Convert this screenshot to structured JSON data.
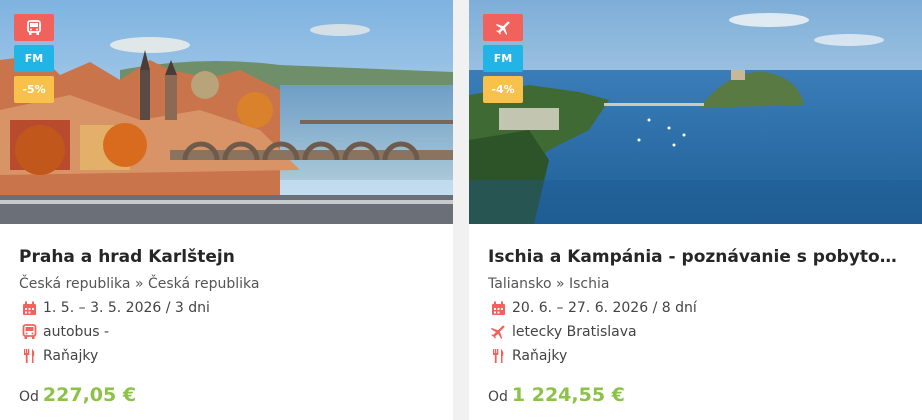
{
  "cards": [
    {
      "badges": {
        "fm": "FM",
        "discount": "-5%"
      },
      "transport_icon": "bus-icon",
      "title": "Praha a hrad Karlštejn",
      "location": "Česká republika » Česká republika",
      "dates": "1. 5. – 3. 5. 2026 / 3 dni",
      "transport": "autobus -",
      "meal": "Raňajky",
      "price_label": "Od",
      "price": "227,05 €"
    },
    {
      "badges": {
        "fm": "FM",
        "discount": "-4%"
      },
      "transport_icon": "plane-icon",
      "title": "Ischia a Kampánia - poznávanie s pobytom pri mori",
      "location": "Taliansko » Ischia",
      "dates": "20. 6. – 27. 6. 2026 / 8 dní",
      "transport": "letecky Bratislava",
      "meal": "Raňajky",
      "price_label": "Od",
      "price": "1 224,55 €"
    }
  ],
  "colors": {
    "badge_transport": "#f0625b",
    "badge_fm": "#21b4e6",
    "badge_discount": "#f7c14c",
    "icon": "#f0625b",
    "price": "#8cc24a"
  }
}
